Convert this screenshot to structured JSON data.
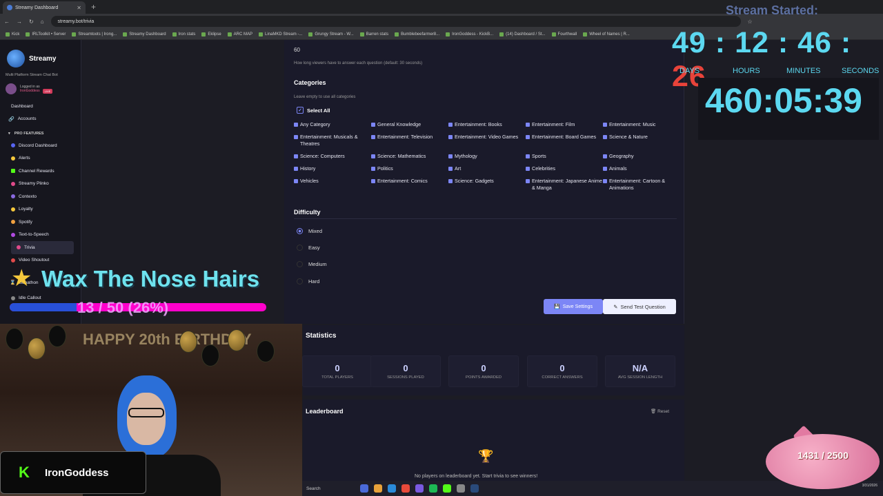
{
  "browser": {
    "tab_title": "Streamy Dashboard",
    "url": "streamy.bot/trivia",
    "bookmarks": [
      "Kick",
      "IRLToolkit • Server",
      "Streamtoots | Irong...",
      "Streamy Dashboard",
      "Iron stats",
      "Eklipse",
      "ARC MAP",
      "LinaMKD Stream -...",
      "Grungy Stream - W...",
      "Barren stats",
      "Bumblebeefarmer8...",
      "IronGoddess - KickB...",
      "(14) Dashboard / St...",
      "Fourthwall",
      "Wheel of Names | R..."
    ]
  },
  "sidebar": {
    "brand": "Streamy",
    "tagline": "Multi Platform Stream Chat Bot",
    "logged_in_label": "Logged in as",
    "username": "IronGoddess",
    "live_badge": "LIVE",
    "top_items": [
      {
        "label": "Dashboard"
      },
      {
        "label": "Accounts"
      }
    ],
    "section_label": "PRO FEATURES",
    "items": [
      {
        "label": "Discord Dashboard"
      },
      {
        "label": "Alerts"
      },
      {
        "label": "Channel Rewards"
      },
      {
        "label": "Streamy Plinko"
      },
      {
        "label": "Contexto"
      },
      {
        "label": "Loyalty"
      },
      {
        "label": "Spotify"
      },
      {
        "label": "Text-to-Speech"
      },
      {
        "label": "Trivia"
      },
      {
        "label": "Video Shoutout"
      }
    ],
    "bottom_items": [
      {
        "label": "Subathon"
      },
      {
        "label": "Idle Callout"
      }
    ]
  },
  "settings": {
    "time_value": "60",
    "time_hint": "How long viewers have to answer each question (default: 30 seconds)",
    "categories_title": "Categories",
    "categories_hint": "Leave empty to use all categories",
    "select_all": "Select All",
    "categories": [
      "Any Category",
      "General Knowledge",
      "Entertainment: Books",
      "Entertainment: Film",
      "Entertainment: Music",
      "Entertainment: Musicals & Theatres",
      "Entertainment: Television",
      "Entertainment: Video Games",
      "Entertainment: Board Games",
      "Science & Nature",
      "Science: Computers",
      "Science: Mathematics",
      "Mythology",
      "Sports",
      "Geography",
      "History",
      "Politics",
      "Art",
      "Celebrities",
      "Animals",
      "Vehicles",
      "Entertainment: Comics",
      "Science: Gadgets",
      "Entertainment: Japanese Anime & Manga",
      "Entertainment: Cartoon & Animations"
    ],
    "difficulty_title": "Difficulty",
    "difficulties": [
      "Mixed",
      "Easy",
      "Medium",
      "Hard"
    ],
    "selected_difficulty": "Mixed",
    "save_label": "Save Settings",
    "test_label": "Send Test Question"
  },
  "statistics": {
    "title": "Statistics",
    "items": [
      {
        "value": "0",
        "label": "TOTAL PLAYERS"
      },
      {
        "value": "0",
        "label": "SESSIONS PLAYED"
      },
      {
        "value": "0",
        "label": "POINTS AWARDED"
      },
      {
        "value": "0",
        "label": "CORRECT ANSWERS"
      },
      {
        "value": "N/A",
        "label": "AVG SESSION LENGTH"
      }
    ]
  },
  "leaderboard": {
    "title": "Leaderboard",
    "reset_label": "Reset",
    "empty_text": "No players on leaderboard yet. Start trivia to see winners!"
  },
  "overlay": {
    "stream_started": "Stream Started:",
    "countdown": {
      "days": "49",
      "hours": "12",
      "minutes": "46",
      "seconds": "26"
    },
    "countdown_labels": {
      "days": "DAYS",
      "hours": "HOURS",
      "minutes": "MINUTES",
      "seconds": "SECONDS"
    },
    "subathon_timer": "460:05:39",
    "goal_title": "Wax The Nose Hairs",
    "goal_progress_text": "13 / 50 (26%)",
    "goal_progress_fraction": 0.26,
    "cam_banner": "HAPPY 20th BIRTHDAY",
    "streamer_name": "IronGoddess",
    "pig_counter": "1431 / 2500"
  },
  "taskbar": {
    "search": "Search",
    "date": "3/31/2026"
  }
}
